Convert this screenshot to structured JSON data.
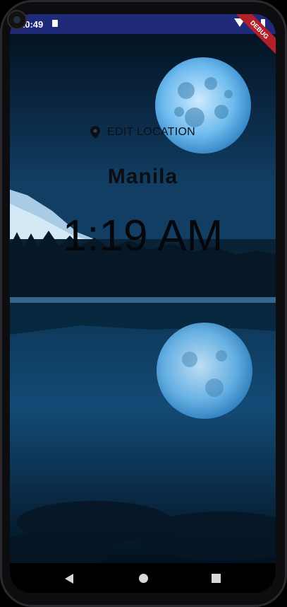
{
  "status_bar": {
    "time": "10:49",
    "sd_icon": "sd-card-icon",
    "wifi_icon": "wifi-icon",
    "battery_icon": "battery-icon"
  },
  "debug_banner": "DEBUG",
  "location": {
    "edit_label": "EDIT LOCATION",
    "icon": "location-pin-icon"
  },
  "city": "Manila",
  "time_display": "1:19 AM",
  "nav_bar": {
    "back_icon": "back-icon",
    "home_icon": "home-icon",
    "recents_icon": "recents-icon"
  },
  "colors": {
    "status_bar": "#1f2a78",
    "sky": "#0a2440",
    "moon": "#5fb4ea",
    "text": "#0b0d12"
  }
}
